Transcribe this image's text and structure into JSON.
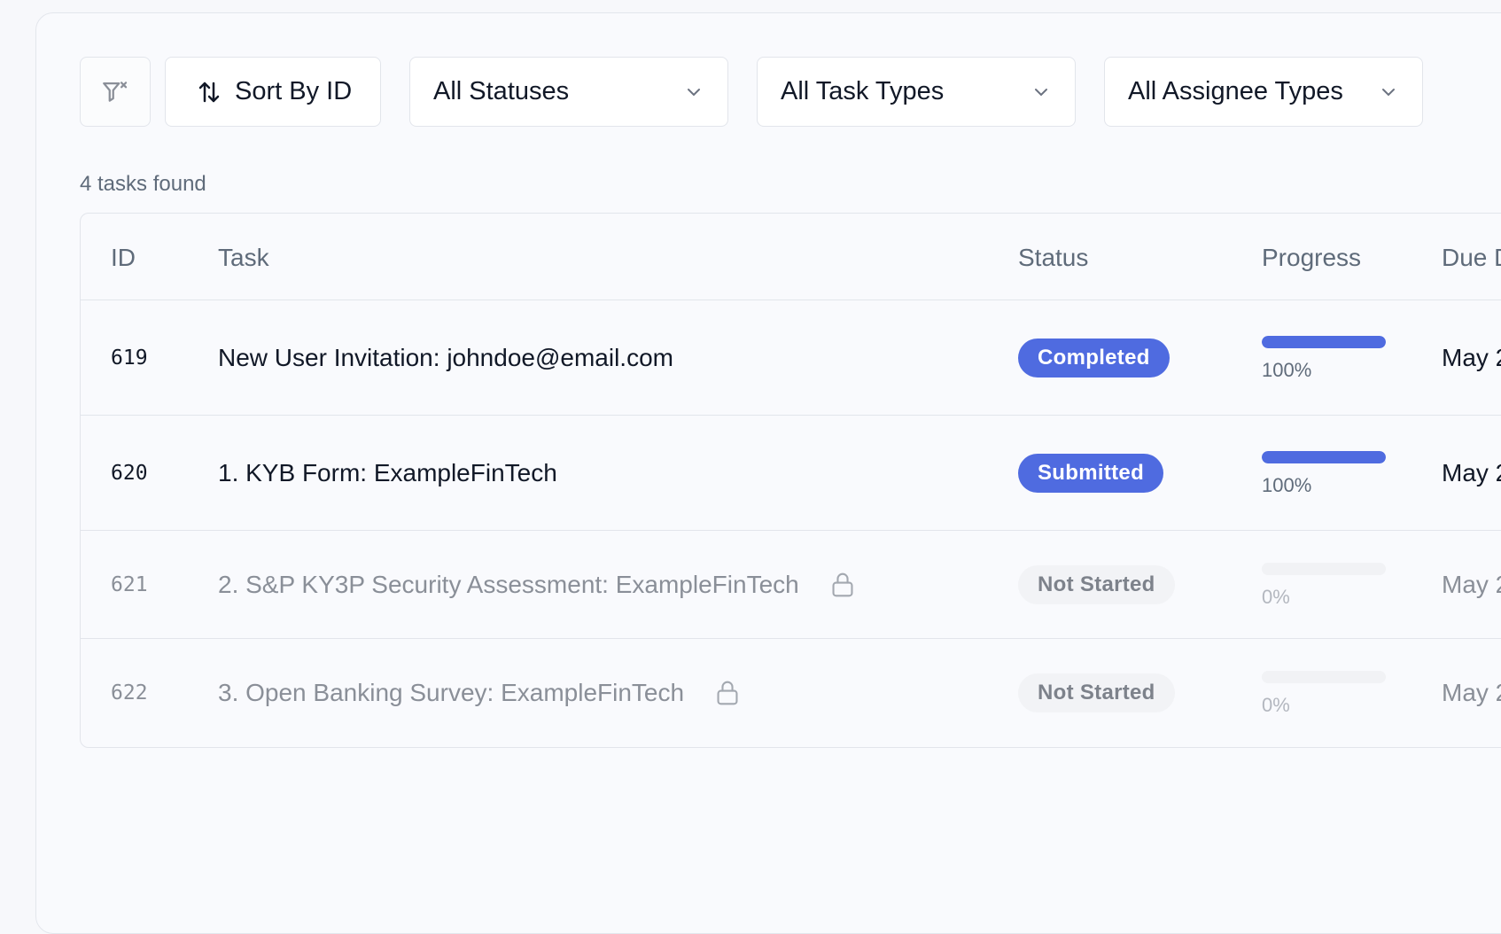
{
  "toolbar": {
    "clear_filter_icon": "filter-clear-icon",
    "sort_label": "Sort By ID",
    "sort_icon": "sort-arrows-icon",
    "status_select": "All Statuses",
    "task_type_select": "All Task Types",
    "assignee_type_select": "All Assignee Types"
  },
  "results": {
    "count_text": "4 tasks found"
  },
  "table": {
    "headers": {
      "id": "ID",
      "task": "Task",
      "status": "Status",
      "progress": "Progress",
      "due": "Due D"
    },
    "rows": [
      {
        "id": "619",
        "task": "New User Invitation: johndoe@email.com",
        "status": "Completed",
        "progress": 1.0,
        "progress_label": "100%",
        "due": "May 2",
        "locked": false
      },
      {
        "id": "620",
        "task": "1. KYB Form: ExampleFinTech",
        "status": "Submitted",
        "progress": 1.0,
        "progress_label": "100%",
        "due": "May 2",
        "locked": false
      },
      {
        "id": "621",
        "task": "2. S&P KY3P Security Assessment: ExampleFinTech",
        "status": "Not Started",
        "progress": 0,
        "progress_label": "0%",
        "due": "May 2",
        "locked": true
      },
      {
        "id": "622",
        "task": "3. Open Banking Survey: ExampleFinTech",
        "status": "Not Started",
        "progress": 0,
        "progress_label": "0%",
        "due": "May 2",
        "locked": true
      }
    ]
  },
  "colors": {
    "accent": "#4f6be0",
    "muted_text": "#8a8f98",
    "badge_grey": "#f2f3f6"
  }
}
